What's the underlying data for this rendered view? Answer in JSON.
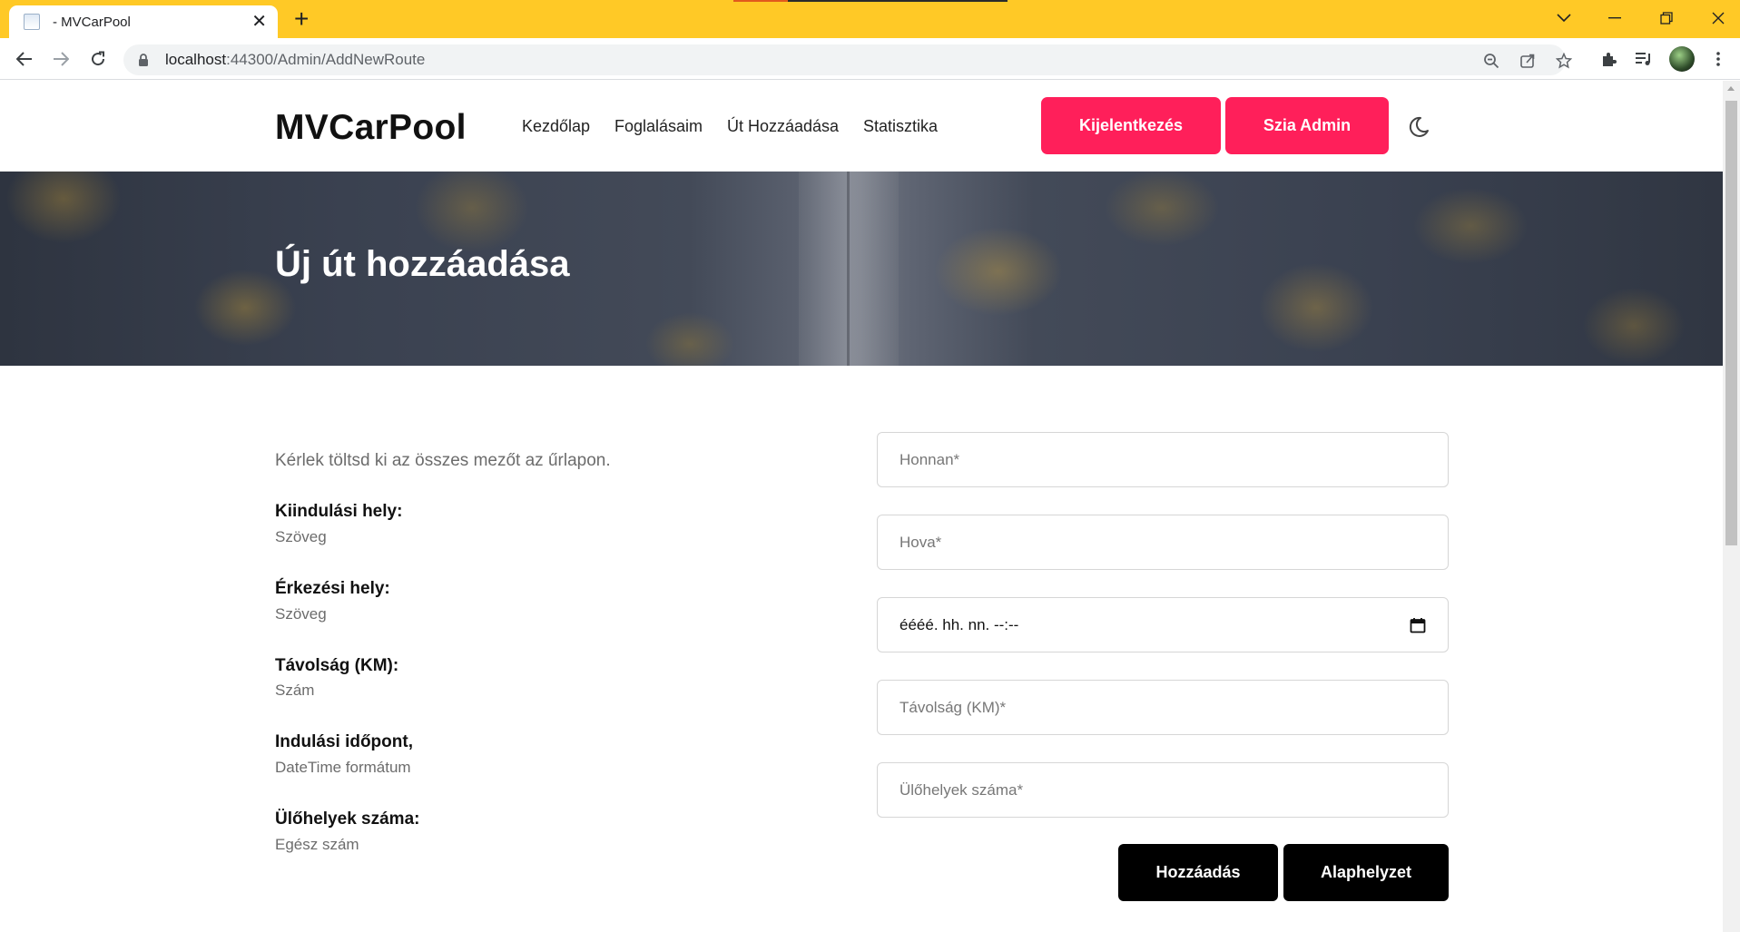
{
  "browser": {
    "tab_title": "- MVCarPool",
    "tab_close": "✕",
    "new_tab": "+",
    "url_host": "localhost",
    "url_port_path": ":44300/Admin/AddNewRoute",
    "window_controls": [
      "⌄",
      "—",
      "❐",
      "✕"
    ],
    "accent_color": "#ffc926"
  },
  "nav": {
    "brand": "MVCarPool",
    "links": [
      "Kezdőlap",
      "Foglalásaim",
      "Út Hozzáadása",
      "Statisztika"
    ],
    "logout": "Kijelentkezés",
    "greeting": "Szia Admin",
    "button_color": "#ff1f5a"
  },
  "hero": {
    "title": "Új út hozzáadása"
  },
  "form_info": {
    "intro": "Kérlek töltsd ki az összes mezőt az űrlapon.",
    "items": [
      {
        "label": "Kiindulási hely:",
        "hint": "Szöveg"
      },
      {
        "label": "Érkezési hely:",
        "hint": "Szöveg"
      },
      {
        "label": "Távolság (KM):",
        "hint": "Szám"
      },
      {
        "label": "Indulási időpont,",
        "hint": "DateTime formátum"
      },
      {
        "label": "Ülőhelyek száma:",
        "hint": "Egész szám"
      }
    ]
  },
  "form": {
    "from_placeholder": "Honnan*",
    "to_placeholder": "Hova*",
    "datetime_value": "éééé. hh. nn. --:--",
    "distance_placeholder": "Távolság (KM)*",
    "seats_placeholder": "Ülőhelyek száma*",
    "submit": "Hozzáadás",
    "reset": "Alaphelyzet"
  }
}
